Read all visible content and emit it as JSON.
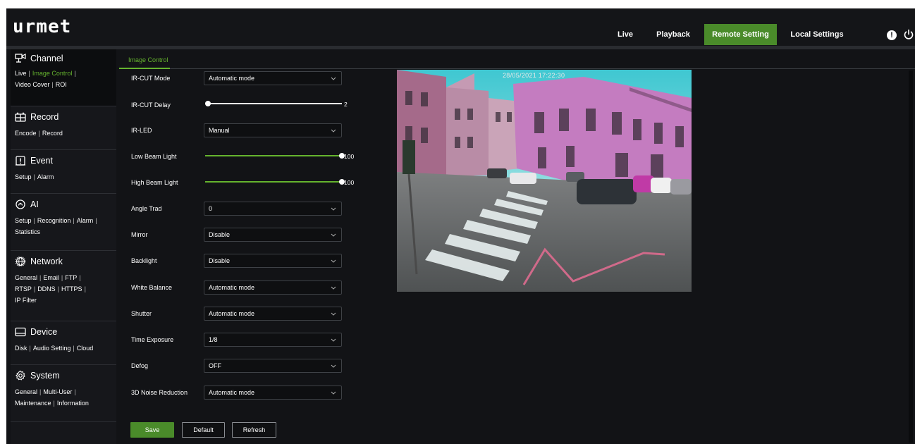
{
  "header": {
    "logo": "urmet",
    "nav": [
      {
        "label": "Live"
      },
      {
        "label": "Playback"
      },
      {
        "label": "Remote Setting"
      },
      {
        "label": "Local Settings"
      }
    ],
    "active_nav": "Remote Setting",
    "accent_color": "#4a8b2a",
    "alert_icon": "exclamation-circle-icon",
    "power_icon": "power-icon"
  },
  "sidebar": {
    "sections": [
      {
        "title": "Channel",
        "icon": "channel-icon",
        "links": [
          "Live",
          "Image Control",
          "Video Cover",
          "ROI"
        ],
        "active": "Image Control"
      },
      {
        "title": "Record",
        "icon": "record-icon",
        "links": [
          "Encode",
          "Record"
        ]
      },
      {
        "title": "Event",
        "icon": "event-icon",
        "links": [
          "Setup",
          "Alarm"
        ]
      },
      {
        "title": "AI",
        "icon": "ai-icon",
        "links": [
          "Setup",
          "Recognition",
          "Alarm",
          "Statistics"
        ]
      },
      {
        "title": "Network",
        "icon": "network-icon",
        "links": [
          "General",
          "Email",
          "FTP",
          "RTSP",
          "DDNS",
          "HTTPS",
          "IP Filter"
        ]
      },
      {
        "title": "Device",
        "icon": "device-icon",
        "links": [
          "Disk",
          "Audio Setting",
          "Cloud"
        ]
      },
      {
        "title": "System",
        "icon": "gear-icon",
        "links": [
          "General",
          "Multi-User",
          "Maintenance",
          "Information"
        ]
      }
    ]
  },
  "tab": {
    "label": "Image Control"
  },
  "form": {
    "ircut_mode": {
      "label": "IR-CUT Mode",
      "value": "Automatic mode"
    },
    "ircut_delay": {
      "label": "IR-CUT Delay",
      "value": 2,
      "display": "2",
      "max": 100
    },
    "ir_led": {
      "label": "IR-LED",
      "value": "Manual"
    },
    "low_beam": {
      "label": "Low Beam Light",
      "value": 100,
      "display": "100",
      "max": 100
    },
    "high_beam": {
      "label": "High Beam Light",
      "value": 100,
      "display": "100",
      "max": 100
    },
    "angle_trad": {
      "label": "Angle Trad",
      "value": "0"
    },
    "mirror": {
      "label": "Mirror",
      "value": "Disable"
    },
    "backlight": {
      "label": "Backlight",
      "value": "Disable"
    },
    "white_balance": {
      "label": "White Balance",
      "value": "Automatic mode"
    },
    "shutter": {
      "label": "Shutter",
      "value": "Automatic mode"
    },
    "time_exposure": {
      "label": "Time Exposure",
      "value": "1/8"
    },
    "defog": {
      "label": "Defog",
      "value": "OFF"
    },
    "noise_reduction": {
      "label": "3D Noise Reduction",
      "value": "Automatic mode"
    }
  },
  "preview": {
    "timestamp": "28/05/2021 17:22:30"
  },
  "buttons": {
    "save": "Save",
    "default": "Default",
    "refresh": "Refresh"
  }
}
